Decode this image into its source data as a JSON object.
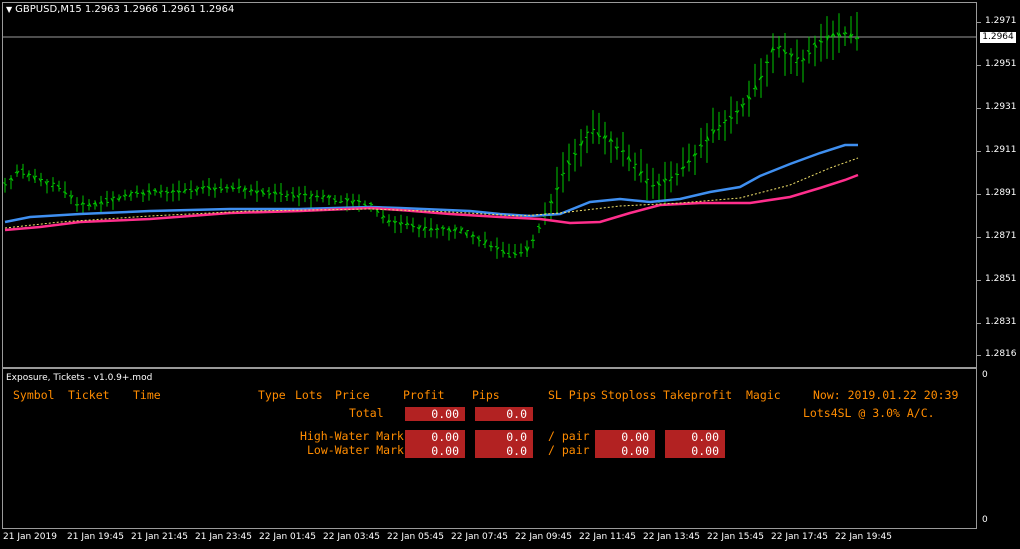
{
  "chart": {
    "symbol_line": "GBPUSD,M15  1.2963 1.2966 1.2961 1.2964",
    "current_price": "1.2964",
    "price_ticks": [
      "1.2971",
      "1.2951",
      "1.2931",
      "1.2911",
      "1.2891",
      "1.2871",
      "1.2851",
      "1.2831",
      "1.2816"
    ],
    "subwindow_scale": [
      "0",
      "0"
    ],
    "time_ticks": [
      "21 Jan 2019",
      "21 Jan 19:45",
      "21 Jan 21:45",
      "21 Jan 23:45",
      "22 Jan 01:45",
      "22 Jan 03:45",
      "22 Jan 05:45",
      "22 Jan 07:45",
      "22 Jan 09:45",
      "22 Jan 11:45",
      "22 Jan 13:45",
      "22 Jan 15:45",
      "22 Jan 17:45",
      "22 Jan 19:45"
    ],
    "colors": {
      "bars": "#00c800",
      "ma_blue": "#3f8ff0",
      "ma_pink": "#ff2e8c",
      "ma_yellow": "#f0e06a",
      "grid": "#9a9a9a"
    }
  },
  "indicator": {
    "name": "Exposure, Tickets - v1.0.9+.mod",
    "headers": {
      "symbol": "Symbol",
      "ticket": "Ticket",
      "time": "Time",
      "type": "Type",
      "lots": "Lots",
      "price": "Price",
      "profit": "Profit",
      "pips": "Pips",
      "sl_pips": "SL Pips",
      "stoploss": "Stoploss",
      "takeprofit": "Takeprofit",
      "magic": "Magic"
    },
    "now": "Now: 2019.01.22 20:39",
    "lots4sl": "Lots4SL @ 3.0% A/C.",
    "total": {
      "label": "Total",
      "profit": "0.00",
      "pips": "0.0"
    },
    "high_water": {
      "label": "High-Water Mark",
      "profit": "0.00",
      "pips": "0.0",
      "per_pair": "/ pair",
      "v1": "0.00",
      "v2": "0.00"
    },
    "low_water": {
      "label": "Low-Water Mark",
      "profit": "0.00",
      "pips": "0.0",
      "per_pair": "/ pair",
      "v1": "0.00",
      "v2": "0.00"
    }
  }
}
